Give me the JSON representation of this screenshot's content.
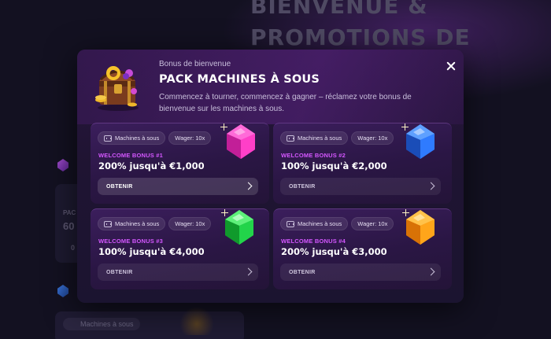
{
  "background": {
    "hero_title": "BIENVENUE & PROMOTIONS DE",
    "left_text_1": "PAC",
    "left_text_2": "60",
    "left_text_3": "0",
    "bottom_chip": "Machines à sous"
  },
  "modal": {
    "subtitle": "Bonus de bienvenue",
    "title": "PACK MACHINES À SOUS",
    "description": "Commencez à tourner, commencez à gagner – réclamez votre bonus de bienvenue sur les machines à sous.",
    "close_icon": "close-icon",
    "header_icon": "treasure-chest-icon"
  },
  "cards": [
    {
      "category": "Machines à sous",
      "wager": "Wager: 10x",
      "label": "WELCOME BONUS #1",
      "value": "200% jusqu'à €1,000",
      "button": "OBTENIR",
      "gem": "pink-gem-icon",
      "gem_color": "#ff3fc8"
    },
    {
      "category": "Machines à sous",
      "wager": "Wager: 10x",
      "label": "WELCOME BONUS #2",
      "value": "100% jusqu'à €2,000",
      "button": "OBTENIR",
      "gem": "blue-gem-icon",
      "gem_color": "#2f7bff"
    },
    {
      "category": "Machines à sous",
      "wager": "Wager: 10x",
      "label": "WELCOME BONUS #3",
      "value": "100% jusqu'à €4,000",
      "button": "OBTENIR",
      "gem": "green-gem-icon",
      "gem_color": "#22d44a"
    },
    {
      "category": "Machines à sous",
      "wager": "Wager: 10x",
      "label": "WELCOME BONUS #4",
      "value": "200% jusqu'à €3,000",
      "button": "OBTENIR",
      "gem": "orange-gem-icon",
      "gem_color": "#ffa51a"
    }
  ],
  "colors": {
    "accent_label": "#d457ff",
    "modal_bg": "#1f1432",
    "page_bg": "#131121"
  }
}
